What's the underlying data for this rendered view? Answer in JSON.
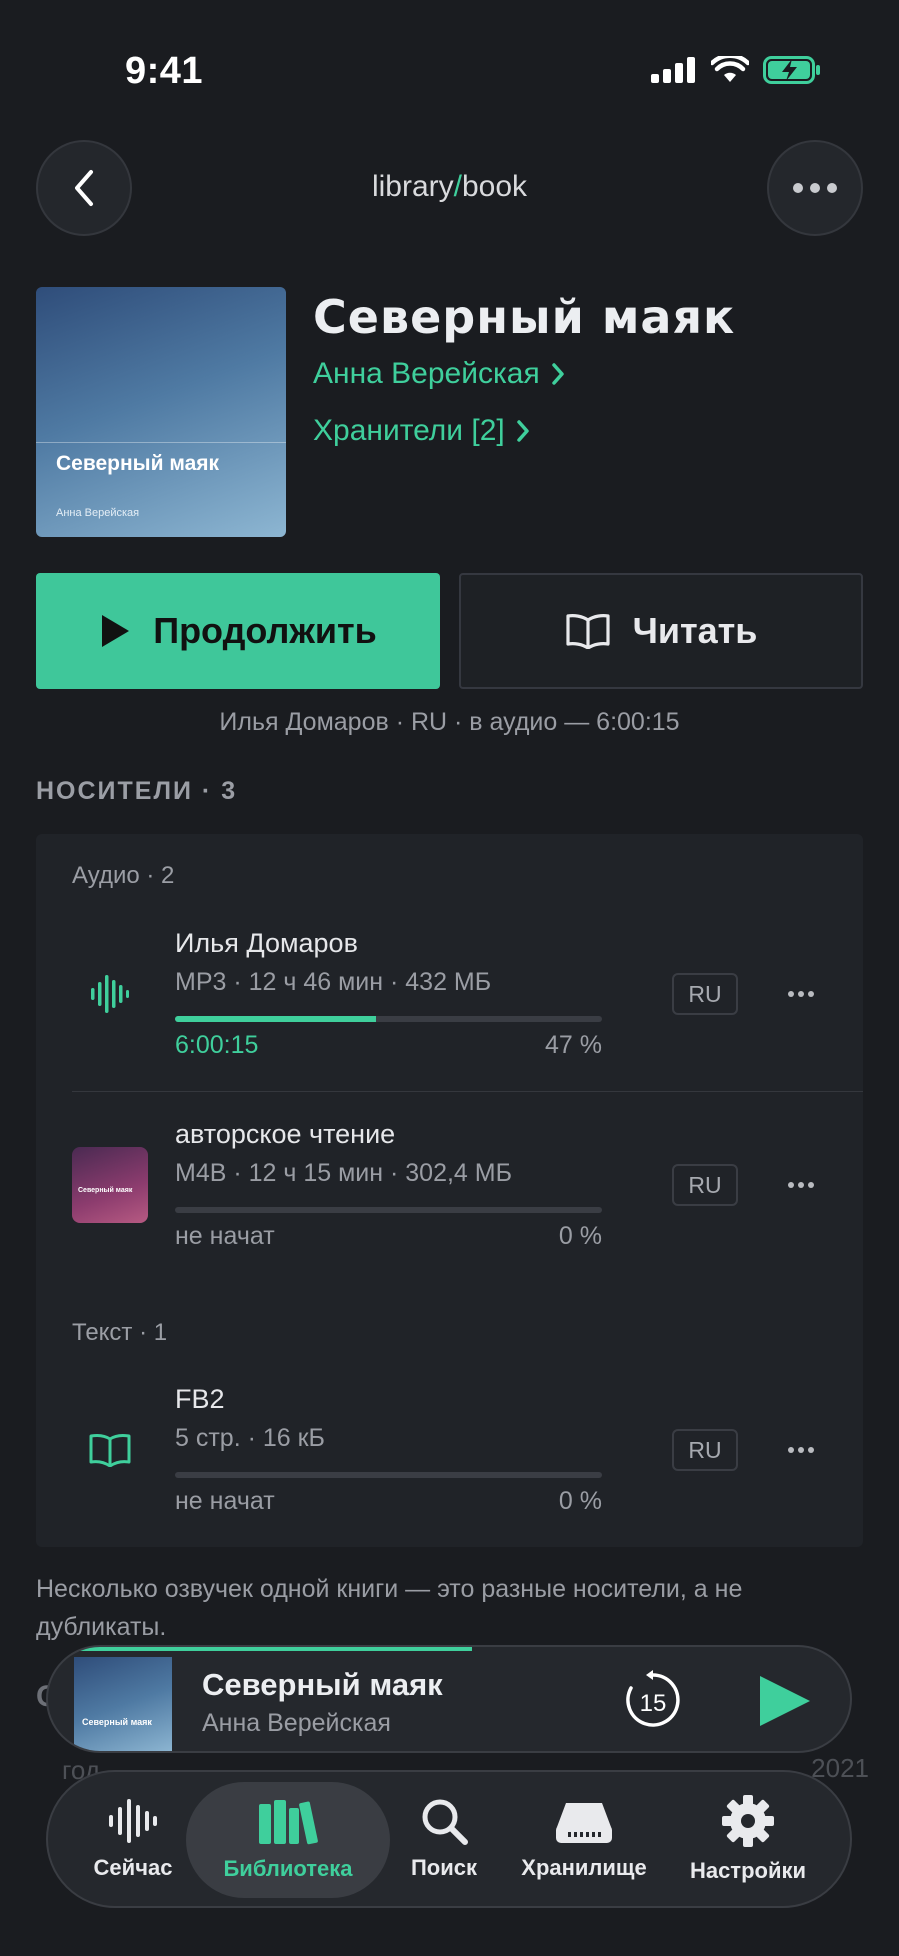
{
  "status_bar": {
    "time": "9:41"
  },
  "header": {
    "breadcrumb_parent": "library",
    "breadcrumb_sep": "/",
    "breadcrumb_current": "book"
  },
  "book": {
    "title": "Северный маяк",
    "author": "Анна Верейская",
    "keepers": "Хранители [2]",
    "cover_title": "Северный маяк",
    "cover_author": "Анна Верейская"
  },
  "actions": {
    "continue_label": "Продолжить",
    "read_label": "Читать"
  },
  "sub_info": "Илья Домаров · RU · в аудио — 6:00:15",
  "media_section": {
    "header": "НОСИТЕЛИ · 3",
    "audio_group_label": "Аудио · 2",
    "text_group_label": "Текст · 1",
    "items": [
      {
        "title": "Илья Домаров",
        "meta": "MP3 · 12 ч 46 мин · 432 МБ",
        "status": "6:00:15",
        "percent": "47 %",
        "progress": 0.47,
        "lang": "RU",
        "icon": "waveform-icon"
      },
      {
        "title": "авторское чтение",
        "meta": "M4B · 12 ч 15 мин · 302,4 МБ",
        "status": "не начат",
        "percent": "0 %",
        "progress": 0,
        "lang": "RU",
        "thumb_title": "Северный маяк"
      },
      {
        "title": "FB2",
        "meta": "5 стр. · 16 кБ",
        "status": "не начат",
        "percent": "0 %",
        "progress": 0,
        "lang": "RU",
        "icon": "book-open-icon"
      }
    ]
  },
  "note": "Несколько озвучек одной книги — это разные носители, а не дубликаты.",
  "below_content": {
    "label_partial": "С",
    "year_label_partial": "год",
    "year_value": "2021"
  },
  "mini_player": {
    "title": "Северный маяк",
    "author": "Анна Верейская",
    "cover_title": "Северный маяк",
    "skip_seconds": "15",
    "progress": 0.47
  },
  "tabs": [
    {
      "label": "Сейчас",
      "icon": "waveform-icon"
    },
    {
      "label": "Библиотека",
      "icon": "books-icon",
      "active": true
    },
    {
      "label": "Поиск",
      "icon": "search-icon"
    },
    {
      "label": "Хранилище",
      "icon": "storage-icon"
    },
    {
      "label": "Настройки",
      "icon": "gear-icon"
    }
  ],
  "colors": {
    "accent": "#3fcf9c",
    "background": "#1a1c20",
    "card": "#202328"
  }
}
